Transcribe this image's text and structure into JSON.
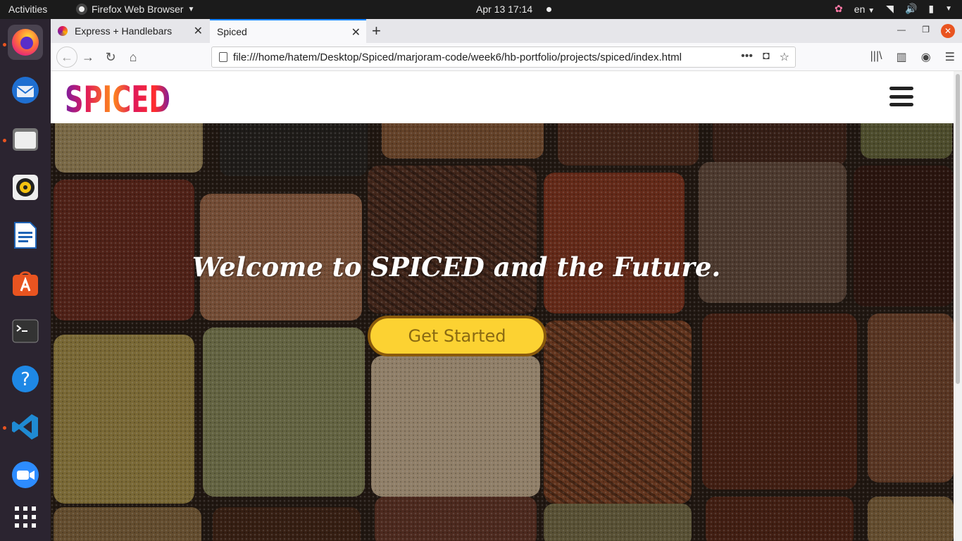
{
  "system": {
    "activities": "Activities",
    "app_menu": "Firefox Web Browser",
    "clock": "Apr 13  17:14",
    "language": "en"
  },
  "browser": {
    "tabs": [
      {
        "label": "Express + Handlebars"
      },
      {
        "label": "Spiced"
      }
    ],
    "url": "file:///home/hatem/Desktop/Spiced/marjoram-code/week6/hb-portfolio/projects/spiced/index.html"
  },
  "site": {
    "logo_text": "SPICED",
    "hero_title": "Welcome to SPICED and the Future.",
    "cta_label": "Get Started"
  },
  "colors": {
    "accent": "#fcd232",
    "cta_border": "#8a5a0c",
    "dock_bg": "#2b2430",
    "ubuntu_orange": "#e95420"
  }
}
